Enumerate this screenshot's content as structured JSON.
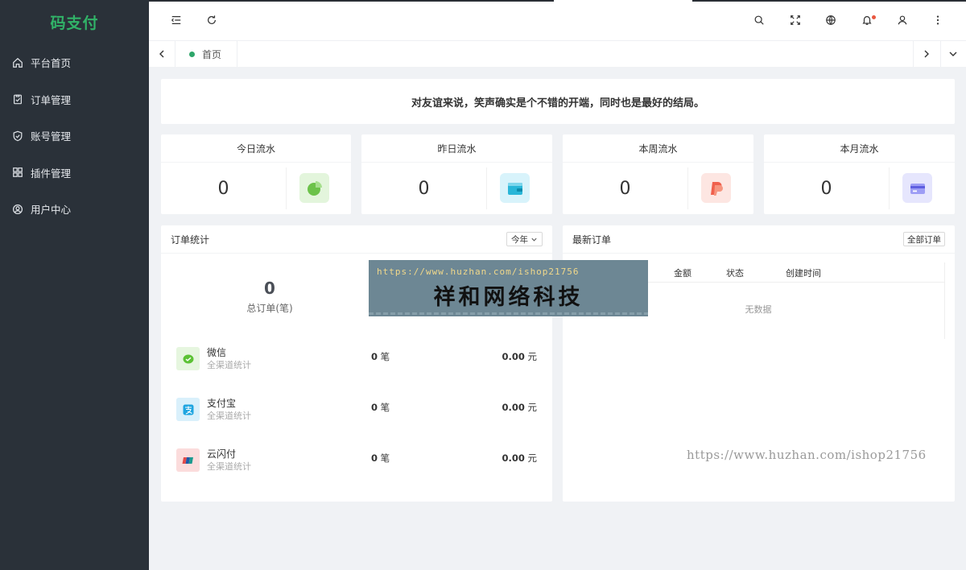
{
  "app": {
    "logo": "码支付"
  },
  "sidebar": {
    "items": [
      {
        "label": "平台首页",
        "icon": "home-icon"
      },
      {
        "label": "订单管理",
        "icon": "clipboard-check-icon"
      },
      {
        "label": "账号管理",
        "icon": "shield-check-icon"
      },
      {
        "label": "插件管理",
        "icon": "grid-icon"
      },
      {
        "label": "用户中心",
        "icon": "user-circle-icon"
      }
    ]
  },
  "header": {
    "icons": [
      "menu-fold-icon",
      "refresh-icon",
      "search-icon",
      "fullscreen-icon",
      "globe-icon",
      "bell-icon",
      "user-icon",
      "more-vertical-icon"
    ]
  },
  "tabs": {
    "home_label": "首页"
  },
  "notice": {
    "text": "对友谊来说，笑声确实是个不错的开端，同时也是最好的结局。"
  },
  "stats": [
    {
      "title": "今日流水",
      "value": "0",
      "icon": "pie-chart-icon",
      "color": "#6cc24a",
      "bg": "#e3f5dc"
    },
    {
      "title": "昨日流水",
      "value": "0",
      "icon": "wallet-icon",
      "color": "#29b6d8",
      "bg": "#d8f3fb"
    },
    {
      "title": "本周流水",
      "value": "0",
      "icon": "paypal-icon",
      "color": "#f0604d",
      "bg": "#fde6e2"
    },
    {
      "title": "本月流水",
      "value": "0",
      "icon": "card-icon",
      "color": "#7c7cf0",
      "bg": "#e6e6fd"
    }
  ],
  "order_stats": {
    "title": "订单统计",
    "year_select": "今年",
    "total": "0",
    "total_label": "总订单(笔)",
    "channels": [
      {
        "name": "微信",
        "sub": "全渠道统计",
        "count": "0",
        "count_unit": "笔",
        "amount": "0.00",
        "amount_unit": "元",
        "icon": "wechat-icon",
        "color": "#5cc235",
        "bg": "#e6f6df"
      },
      {
        "name": "支付宝",
        "sub": "全渠道统计",
        "count": "0",
        "count_unit": "笔",
        "amount": "0.00",
        "amount_unit": "元",
        "icon": "alipay-icon",
        "color": "#1fa5e0",
        "bg": "#d9f0fb"
      },
      {
        "name": "云闪付",
        "sub": "全渠道统计",
        "count": "0",
        "count_unit": "笔",
        "amount": "0.00",
        "amount_unit": "元",
        "icon": "unionpay-icon",
        "color": "#e24a4a",
        "bg": "#fbdcdc"
      }
    ]
  },
  "latest_orders": {
    "title": "最新订单",
    "all_button": "全部订单",
    "columns": [
      "金额",
      "状态",
      "创建时间"
    ],
    "empty_text": "无数据"
  },
  "watermark": {
    "url": "https://www.huzhan.com/ishop21756",
    "title": "祥和网络科技",
    "url_bottom": "https://www.huzhan.com/ishop21756"
  }
}
